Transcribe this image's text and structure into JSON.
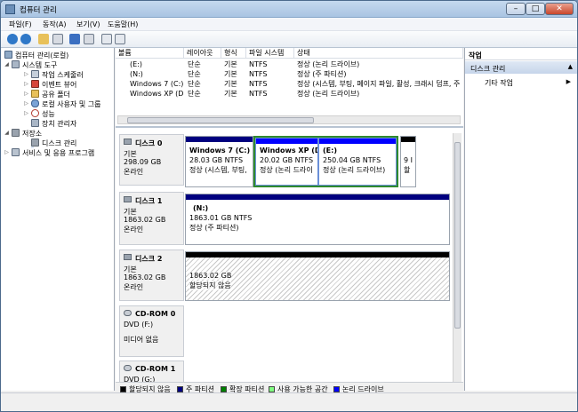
{
  "window": {
    "title": "컴퓨터 관리",
    "min": "–",
    "max": "□",
    "close": "✕"
  },
  "menu": [
    "파일(F)",
    "동작(A)",
    "보기(V)",
    "도움말(H)"
  ],
  "icons": {
    "back": "back-arrow-icon",
    "forward": "forward-arrow-icon",
    "up": "folder-up-icon",
    "console": "console-tree-icon",
    "help": "help-icon",
    "props": "properties-icon",
    "refresh": "refresh-icon",
    "export": "export-icon"
  },
  "tree": {
    "root": "컴퓨터 관리(로컬)",
    "system_tools": "시스템 도구",
    "task_scheduler": "작업 스케줄러",
    "event_viewer": "이벤트 뷰어",
    "shared_folders": "공유 폴더",
    "local_users": "로컬 사용자 및 그룹",
    "performance": "성능",
    "device_manager": "장치 관리자",
    "storage": "저장소",
    "disk_management": "디스크 관리",
    "services": "서비스 및 응용 프로그램"
  },
  "volume_headers": [
    "볼륨",
    "레이아웃",
    "형식",
    "파일 시스템",
    "상태"
  ],
  "volumes": [
    {
      "name": "(E:)",
      "layout": "단순",
      "type": "기본",
      "fs": "NTFS",
      "status": "정상 (논리 드라이브)"
    },
    {
      "name": "(N:)",
      "layout": "단순",
      "type": "기본",
      "fs": "NTFS",
      "status": "정상 (주 파티션)"
    },
    {
      "name": "Windows 7 (C:)",
      "layout": "단순",
      "type": "기본",
      "fs": "NTFS",
      "status": "정상 (시스템, 부팅, 페이지 파일, 활성, 크래시 덤프, 주"
    },
    {
      "name": "Windows XP (D:)",
      "layout": "단순",
      "type": "기본",
      "fs": "NTFS",
      "status": "정상 (논리 드라이브)"
    }
  ],
  "disks": {
    "disk0": {
      "name": "디스크 0",
      "type": "기본",
      "size": "298.09 GB",
      "state": "온라인"
    },
    "disk1": {
      "name": "디스크 1",
      "type": "기본",
      "size": "1863.02 GB",
      "state": "온라인"
    },
    "disk2": {
      "name": "디스크 2",
      "type": "기본",
      "size": "1863.02 GB",
      "state": "온라인"
    },
    "cdrom0": {
      "name": "CD-ROM 0",
      "type": "DVD (F:)",
      "state": "미디어 없음"
    },
    "cdrom1": {
      "name": "CD-ROM 1",
      "type": "DVD (G:)"
    }
  },
  "partitions": {
    "c": {
      "name": "Windows 7  (C:)",
      "size": "28.03 GB NTFS",
      "status": "정상 (시스템, 부팅,"
    },
    "d": {
      "name": "Windows XP  (D",
      "size": "20.02 GB NTFS",
      "status": "정상 (논리 드라이"
    },
    "e": {
      "name": "(E:)",
      "size": "250.04 GB NTFS",
      "status": "정상 (논리 드라이브)"
    },
    "tiny": {
      "l1": "9 I",
      "l2": "할"
    },
    "n": {
      "name": "(N:)",
      "size": "1863.01 GB NTFS",
      "status": "정상 (주 파티션)"
    },
    "u": {
      "size": "1863.02 GB",
      "status": "할당되지 않음"
    }
  },
  "legend": [
    "할당되지 않음",
    "주 파티션",
    "확장 파티션",
    "사용 가능한 공간",
    "논리 드라이브"
  ],
  "colors": {
    "unallocated": "#000000",
    "primary": "#00007f",
    "extended": "#008000",
    "free": "#80ff80",
    "logical": "#0000ff",
    "selected_border": "#2f8a2f",
    "header_blue": "#00007f"
  },
  "actions": {
    "title": "작업",
    "section": "디스크 관리",
    "more": "기타 작업",
    "section_arrow": "▲",
    "more_arrow": "▶"
  }
}
